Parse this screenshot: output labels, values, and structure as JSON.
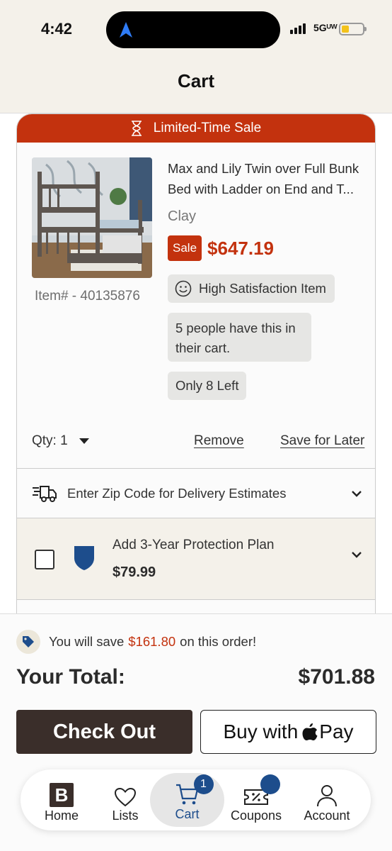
{
  "status_bar": {
    "time": "4:42",
    "network": "5Gᵁᵂ"
  },
  "header": {
    "title": "Cart"
  },
  "cart_item": {
    "banner": "Limited-Time Sale",
    "name": "Max and Lily Twin over Full Bunk Bed with Ladder on End and T...",
    "variant": "Clay",
    "sale_label": "Sale",
    "price": "$647.19",
    "item_number": "Item# - 40135876",
    "badge_satisfaction": "High Satisfaction Item",
    "badge_cart": "5 people have this in their cart.",
    "badge_stock": "Only 8 Left",
    "qty_label": "Qty: 1",
    "remove_label": "Remove",
    "save_label": "Save for Later"
  },
  "delivery": {
    "label": "Enter Zip Code for Delivery Estimates"
  },
  "protection": {
    "title": "Add 3-Year Protection Plan",
    "price": "$79.99",
    "checked": false
  },
  "summary": {
    "save_prefix": "You will save",
    "save_amount": "$161.80",
    "save_suffix": "on this order!",
    "total_label": "Your Total:",
    "total_value": "$701.88",
    "checkout_label": "Check Out",
    "applepay_prefix": "Buy with",
    "applepay_suffix": "Pay"
  },
  "tabbar": {
    "home": "Home",
    "lists": "Lists",
    "cart": "Cart",
    "cart_count": "1",
    "coupons": "Coupons",
    "account": "Account",
    "home_logo": "B"
  },
  "colors": {
    "accent_red": "#c3320e",
    "brand_blue": "#1d4d8c",
    "dark_brown": "#3a2e2a",
    "cream": "#f4f1ea"
  }
}
